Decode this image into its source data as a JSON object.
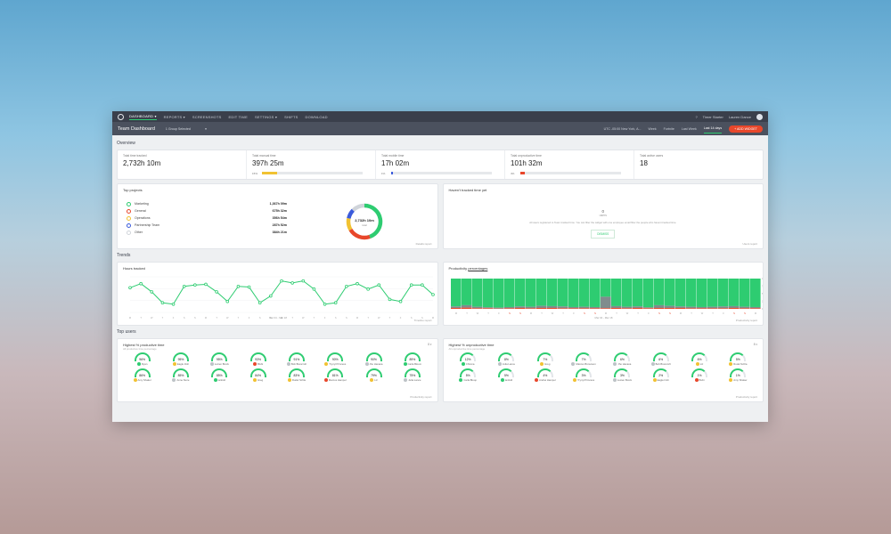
{
  "nav": {
    "items": [
      "DASHBOARD ▾",
      "REPORTS ▾",
      "SCREENSHOTS",
      "EDIT TIME",
      "SETTINGS ▾",
      "SHIFTS",
      "DOWNLOAD"
    ],
    "timer": "Timer Starter",
    "user": "Lauren Dance"
  },
  "subnav": {
    "title": "Team Dashboard",
    "group": "1 Group Selected",
    "timezone": "UTC -05:00 New York, A...",
    "ranges": [
      "Week",
      "Fortnite",
      "Last Week",
      "Last 14 days"
    ],
    "selected_range": "Last 14 days",
    "add": "+ ADD WIDGET"
  },
  "overview": {
    "title": "Overview",
    "items": [
      {
        "label": "Total time tracked",
        "value": "2,732h 10m"
      },
      {
        "label": "Total manual time",
        "value": "397h 25m",
        "pct": "15%",
        "fill": 0.15,
        "color": "#f1c232"
      },
      {
        "label": "Total mobile time",
        "value": "17h 02m",
        "pct": "1%",
        "fill": 0.01,
        "color": "#3b5bdb"
      },
      {
        "label": "Total unproductive time",
        "value": "101h 32m",
        "pct": "4%",
        "fill": 0.04,
        "color": "#e8472b"
      },
      {
        "label": "Total active users",
        "value": "18"
      }
    ]
  },
  "projects": {
    "title": "Top projects",
    "items": [
      {
        "name": "Marketing",
        "hours": "1,367h 09m",
        "color": "#2ecc71"
      },
      {
        "name": "General",
        "hours": "675h 32m",
        "color": "#e8472b"
      },
      {
        "name": "Operations",
        "hours": "356h 54m",
        "color": "#f1c232"
      },
      {
        "name": "Partnership Team",
        "hours": "287h 52m",
        "color": "#3b5bdb"
      },
      {
        "name": "Other",
        "hours": "384h 21m",
        "color": "#d0d4da"
      }
    ],
    "total": "2,732h 10m",
    "total_sub": "total",
    "link": "Details report"
  },
  "not_tracked": {
    "title": "Haven't tracked time yet",
    "count": "0",
    "unit": "users",
    "text": "All users registered to Team tracked time. You can filter the widget with one employee email filter the people who havent tracked time.",
    "button": "DISMISS",
    "link": "Users report"
  },
  "trends": {
    "title": "Trends",
    "hours_title": "Hours tracked",
    "hours_link": "Timeline report",
    "hours_range": "Mar 04 - Mar 18",
    "prod_title": "Productivity",
    "prod_title_link": "percentages",
    "prod_link": "Productivity report",
    "prod_range": "Mar 04 - Mar 18"
  },
  "chart_data": [
    {
      "type": "line",
      "title": "Hours tracked",
      "x": [
        "M",
        "T",
        "W",
        "T",
        "F",
        "S",
        "S",
        "M",
        "T",
        "W",
        "T",
        "F",
        "S",
        "S",
        "M",
        "T",
        "W",
        "T",
        "F",
        "S",
        "S",
        "M",
        "T",
        "W",
        "T",
        "F",
        "S",
        "S",
        "M"
      ],
      "values": [
        180,
        210,
        150,
        70,
        60,
        190,
        200,
        205,
        150,
        80,
        190,
        185,
        70,
        120,
        230,
        215,
        230,
        170,
        60,
        70,
        190,
        210,
        170,
        200,
        95,
        80,
        200,
        200,
        130
      ],
      "ylim": [
        0,
        260
      ],
      "color": "#2ecc71"
    },
    {
      "type": "bar",
      "title": "Productivity percentages",
      "categories": [
        "M",
        "T",
        "W",
        "T",
        "F",
        "S",
        "S",
        "M",
        "T",
        "W",
        "T",
        "F",
        "S",
        "S",
        "M",
        "T",
        "W",
        "T",
        "F",
        "S",
        "S",
        "M",
        "T",
        "W",
        "T",
        "F",
        "S",
        "S",
        "M"
      ],
      "series": [
        {
          "name": "Productive",
          "color": "#2ecc71",
          "values": [
            92,
            88,
            93,
            95,
            96,
            94,
            92,
            93,
            90,
            91,
            92,
            94,
            93,
            94,
            60,
            91,
            93,
            92,
            95,
            88,
            90,
            92,
            93,
            94,
            93,
            92,
            91,
            93,
            94
          ]
        },
        {
          "name": "Neutral",
          "color": "#7f8c8d",
          "values": [
            5,
            8,
            5,
            3,
            3,
            4,
            5,
            5,
            7,
            6,
            6,
            4,
            5,
            4,
            38,
            6,
            5,
            5,
            3,
            9,
            7,
            5,
            5,
            4,
            5,
            6,
            6,
            5,
            4
          ]
        },
        {
          "name": "Unproductive",
          "color": "#e8472b",
          "values": [
            3,
            4,
            2,
            2,
            1,
            2,
            3,
            2,
            3,
            3,
            2,
            2,
            2,
            2,
            2,
            3,
            2,
            3,
            2,
            3,
            3,
            3,
            2,
            2,
            2,
            2,
            3,
            2,
            2
          ]
        }
      ],
      "ylim": [
        0,
        100
      ],
      "yticks": [
        "100%",
        "75%",
        "50%",
        "25%",
        "0%"
      ]
    }
  ],
  "top_users": {
    "title": "Top users",
    "productive_title": "Highest % productive time",
    "productive_sub": "All productive time percentage",
    "unproductive_title": "Highest % unproductive time",
    "unproductive_sub": "All unproductive time percentage",
    "sort": "8 ▾",
    "link": "Productivity report",
    "productive": [
      {
        "pct": "96%",
        "name": "Ryan",
        "color": "#2ecc71"
      },
      {
        "pct": "95%",
        "name": "Eagle Irish",
        "color": "#f1c232"
      },
      {
        "pct": "95%",
        "name": "Lucien Brock",
        "color": "#bdc3c7"
      },
      {
        "pct": "93%",
        "name": "Bixbi",
        "color": "#e8472b"
      },
      {
        "pct": "91%",
        "name": "Bob Brancroft",
        "color": "#bdc3c7"
      },
      {
        "pct": "90%",
        "name": "Trynyl Princess",
        "color": "#f1c232"
      },
      {
        "pct": "90%",
        "name": "Jho Havana",
        "color": "#bdc3c7"
      },
      {
        "pct": "89%",
        "name": "Carla Bloom",
        "color": "#2ecc71"
      },
      {
        "pct": "86%",
        "name": "Amy Shaker",
        "color": "#f1c232"
      },
      {
        "pct": "85%",
        "name": "Anne Store",
        "color": "#bdc3c7"
      },
      {
        "pct": "85%",
        "name": "Ianfold",
        "color": "#2ecc71"
      },
      {
        "pct": "84%",
        "name": "Greg",
        "color": "#f1c232"
      },
      {
        "pct": "83%",
        "name": "Rudel Schla",
        "color": "#f1c232"
      },
      {
        "pct": "81%",
        "name": "Marcus Hampel",
        "color": "#e8472b"
      },
      {
        "pct": "79%",
        "name": "Liz",
        "color": "#f1c232"
      },
      {
        "pct": "75%",
        "name": "Julia Lance",
        "color": "#bdc3c7"
      }
    ],
    "unproductive": [
      {
        "pct": "12%",
        "name": "Chinma",
        "color": "#2ecc71"
      },
      {
        "pct": "8%",
        "name": "Julia Lance",
        "color": "#bdc3c7"
      },
      {
        "pct": "7%",
        "name": "Greg",
        "color": "#f1c232"
      },
      {
        "pct": "7%",
        "name": "Marcus Brownson",
        "color": "#bdc3c7"
      },
      {
        "pct": "6%",
        "name": "Jho Havana",
        "color": "#bdc3c7"
      },
      {
        "pct": "6%",
        "name": "Bob Brancroft",
        "color": "#bdc3c7"
      },
      {
        "pct": "6%",
        "name": "Liz",
        "color": "#f1c232"
      },
      {
        "pct": "5%",
        "name": "Rudel Schla",
        "color": "#f1c232"
      },
      {
        "pct": "5%",
        "name": "Carla Bloop",
        "color": "#2ecc71"
      },
      {
        "pct": "5%",
        "name": "Ianfold",
        "color": "#2ecc71"
      },
      {
        "pct": "4%",
        "name": "Andrei Hampel",
        "color": "#e8472b"
      },
      {
        "pct": "3%",
        "name": "Trynyl Princess",
        "color": "#f1c232"
      },
      {
        "pct": "3%",
        "name": "Lucien Brock",
        "color": "#bdc3c7"
      },
      {
        "pct": "2%",
        "name": "Eagle Irish",
        "color": "#f1c232"
      },
      {
        "pct": "1%",
        "name": "Bixbi",
        "color": "#e8472b"
      },
      {
        "pct": "1%",
        "name": "Amy Shaker",
        "color": "#f1c232"
      }
    ]
  }
}
